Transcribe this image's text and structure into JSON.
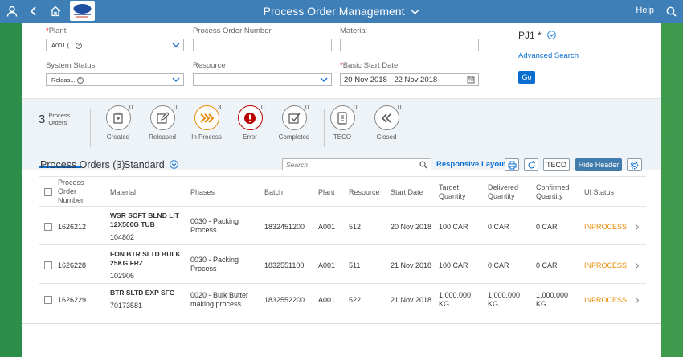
{
  "shell": {
    "title": "Process Order Management",
    "help": "Help",
    "logo_text": "Parkeys Dairy for life"
  },
  "filters": {
    "plant": {
      "label": "Plant",
      "token": "A001 (..."
    },
    "process_order_number": {
      "label": "Process Order Number",
      "value": ""
    },
    "material": {
      "label": "Material",
      "value": ""
    },
    "system_status": {
      "label": "System Status",
      "token": "Releas..."
    },
    "resource": {
      "label": "Resource",
      "value": ""
    },
    "basic_start_date": {
      "label": "Basic Start Date",
      "value": "20 Nov 2018 - 22 Nov 2018"
    },
    "variant": "PJ1 *",
    "advanced_search": "Advanced Search",
    "go": "Go"
  },
  "tabs": {
    "total_count": "3",
    "total_label_1": "Process",
    "total_label_2": "Orders",
    "items": [
      {
        "label": "Created",
        "count": "0"
      },
      {
        "label": "Released",
        "count": "0"
      },
      {
        "label": "In Process",
        "count": "3"
      },
      {
        "label": "Error",
        "count": "0"
      },
      {
        "label": "Completed",
        "count": "0"
      },
      {
        "label": "TECO",
        "count": "0"
      },
      {
        "label": "Closed",
        "count": "0"
      }
    ]
  },
  "table": {
    "title": "Process Orders (3)",
    "view": "Standard",
    "search_placeholder": "Search",
    "responsive_layout": "Responsive Layout",
    "teco_btn": "TECO",
    "hide_header_btn": "Hide Header",
    "headers": {
      "order_1": "Process",
      "order_2": "Order",
      "order_3": "Number",
      "material": "Material",
      "phases": "Phases",
      "batch": "Batch",
      "plant": "Plant",
      "resource": "Resource",
      "start_date": "Start Date",
      "target_1": "Target",
      "target_2": "Quantity",
      "delivered_1": "Delivered",
      "delivered_2": "Quantity",
      "confirmed_1": "Confirmed",
      "confirmed_2": "Quantity",
      "ui_status": "UI Status"
    },
    "rows": [
      {
        "order": "1626212",
        "mat_name_1": "WSR SOFT BLND LIT",
        "mat_name_2": "12X500G TUB",
        "mat_code": "104802",
        "phase_1": "0030 - Packing",
        "phase_2": "Process",
        "batch": "1832451200",
        "plant": "A001",
        "resource": "512",
        "start_date": "20 Nov 2018",
        "target_1": "100 CAR",
        "target_2": "",
        "delivered_1": "0 CAR",
        "delivered_2": "",
        "confirmed_1": "0 CAR",
        "confirmed_2": "",
        "status": "INPROCESS"
      },
      {
        "order": "1626228",
        "mat_name_1": "FON BTR SLTD BULK",
        "mat_name_2": "25KG FRZ",
        "mat_code": "102906",
        "phase_1": "0030 - Packing",
        "phase_2": "Process",
        "batch": "1832551100",
        "plant": "A001",
        "resource": "511",
        "start_date": "21 Nov 2018",
        "target_1": "100 CAR",
        "target_2": "",
        "delivered_1": "0 CAR",
        "delivered_2": "",
        "confirmed_1": "0 CAR",
        "confirmed_2": "",
        "status": "INPROCESS"
      },
      {
        "order": "1626229",
        "mat_name_1": "BTR SLTD EXP SFG",
        "mat_name_2": "",
        "mat_code": "70173581",
        "phase_1": "0020 - Bulk Butter",
        "phase_2": "making process",
        "batch": "1832552200",
        "plant": "A001",
        "resource": "522",
        "start_date": "21 Nov 2018",
        "target_1": "1,000.000",
        "target_2": "KG",
        "delivered_1": "1,000.000",
        "delivered_2": "KG",
        "confirmed_1": "1,000.000",
        "confirmed_2": "KG",
        "status": "INPROCESS"
      }
    ]
  },
  "colors": {
    "shell": "#3f7fb8",
    "accent": "#0a6ed1",
    "status": "#e78c07",
    "error": "#bb0000"
  }
}
